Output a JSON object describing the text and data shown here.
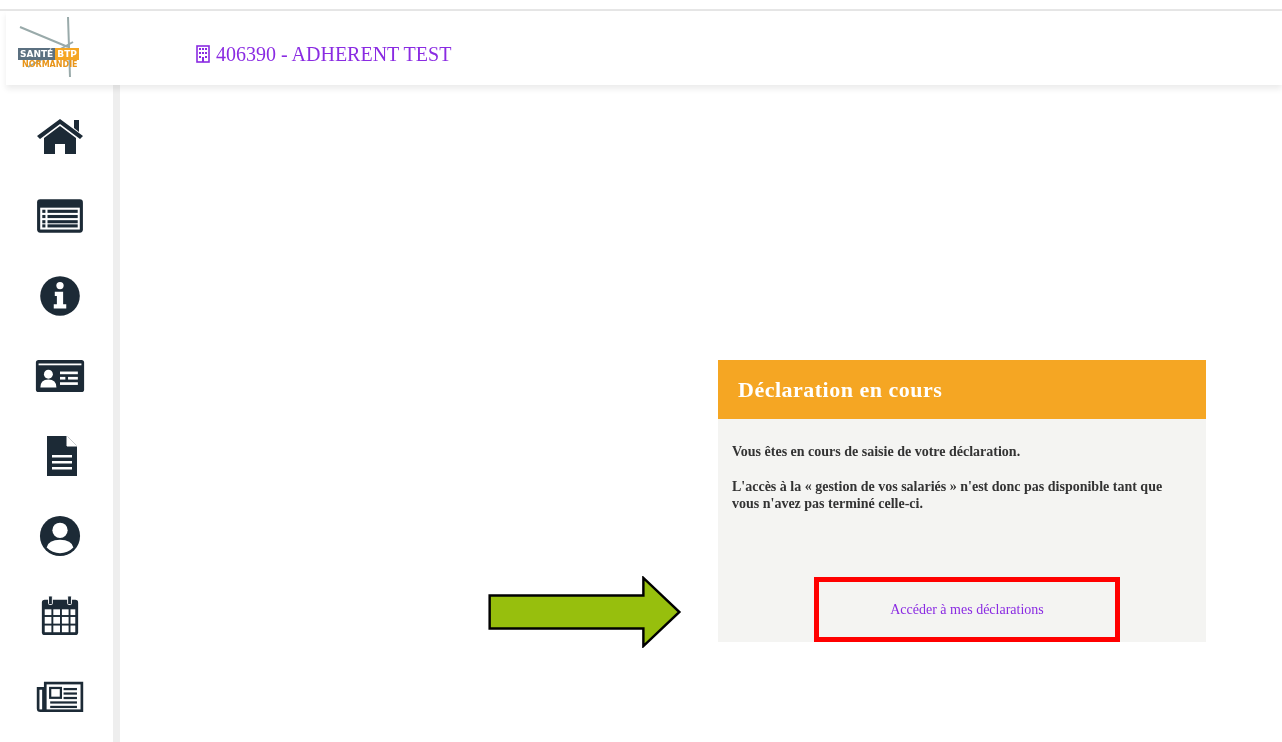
{
  "header": {
    "logo": {
      "word_left": "SANTÉ",
      "word_right": "BTP",
      "subtitle": "NORMANDIE"
    },
    "account": "406390 - ADHERENT TEST"
  },
  "card": {
    "title": "Déclaration en cours",
    "paragraphs": [
      "Vous êtes en cours de saisie de votre déclaration.",
      "L'accès à la « gestion de vos salariés » n'est donc pas disponible tant que vous n'avez pas terminé celle-ci."
    ],
    "link": "Accéder à mes déclarations"
  }
}
